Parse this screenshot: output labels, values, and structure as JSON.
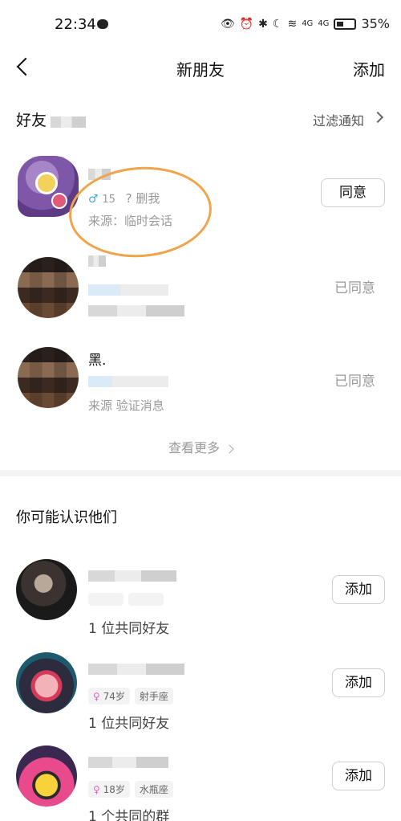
{
  "status_bar": {
    "time": "22:34",
    "battery": "35%",
    "net1": "4G",
    "net2": "4G"
  },
  "nav": {
    "title": "新朋友",
    "add_label": "添加"
  },
  "friends_section": {
    "title": "好友",
    "filter_label": "过滤通知"
  },
  "friend_requests": [
    {
      "age": "15",
      "meta": "? 删我",
      "source": "来源：临时会话",
      "action": "同意"
    },
    {
      "name": "",
      "action": "已同意"
    },
    {
      "name": "黑.",
      "source": "来源   验证消息",
      "action": "已同意"
    }
  ],
  "see_more": "查看更多",
  "know_section": {
    "title": "你可能认识他们"
  },
  "suggestions": [
    {
      "tags": [
        "",
        ""
      ],
      "mutual": "1 位共同好友",
      "action": "添加"
    },
    {
      "tags": [
        "74岁",
        "射手座"
      ],
      "mutual": "1 位共同好友",
      "action": "添加"
    },
    {
      "tags": [
        "18岁",
        "水瓶座"
      ],
      "mutual": "1 个共同的群",
      "action": "添加"
    }
  ]
}
